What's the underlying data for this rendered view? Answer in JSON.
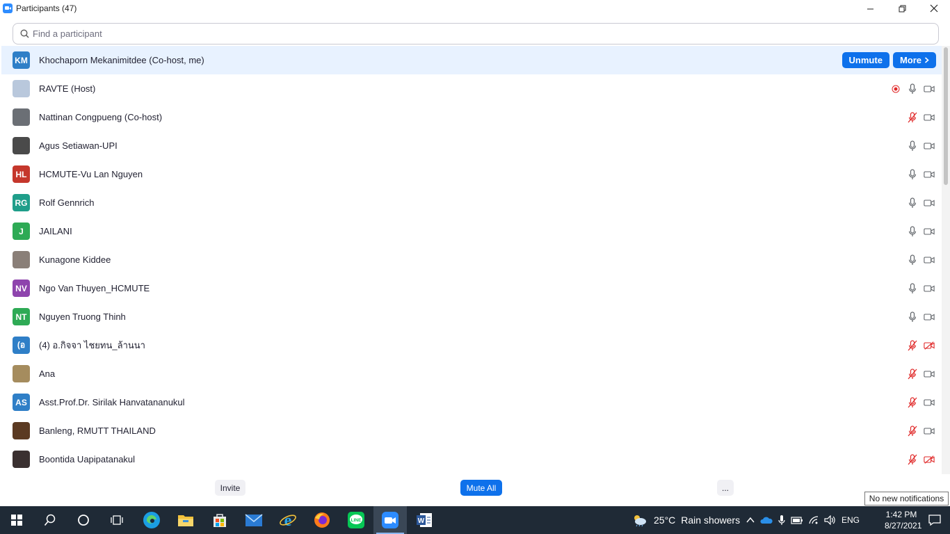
{
  "window": {
    "title": "Participants (47)",
    "minimize": "—",
    "restore": "❐",
    "close": "✕"
  },
  "search": {
    "placeholder": "Find a participant"
  },
  "participants": [
    {
      "initials": "KM",
      "name": "Khochaporn Mekanimitdee (Co-host, me)",
      "color": "#2f7fc7",
      "mic": "none",
      "video": "none",
      "actions": {
        "unmute": "Unmute",
        "more": "More"
      }
    },
    {
      "initials": "",
      "name": "RAVTE (Host)",
      "color": "#b9c8dc",
      "mic": "on",
      "video": "on",
      "recording": true
    },
    {
      "initials": "",
      "name": "Nattinan Congpueng (Co-host)",
      "color": "#6b6f75",
      "mic": "muted",
      "video": "on"
    },
    {
      "initials": "",
      "name": "Agus Setiawan-UPI",
      "color": "#4a4a4a",
      "mic": "on",
      "video": "on"
    },
    {
      "initials": "HL",
      "name": "HCMUTE-Vu Lan Nguyen",
      "color": "#c5372c",
      "mic": "on",
      "video": "on"
    },
    {
      "initials": "RG",
      "name": "Rolf Gennrich",
      "color": "#1f9e8a",
      "mic": "on",
      "video": "on"
    },
    {
      "initials": "J",
      "name": "JAILANI",
      "color": "#2eaa55",
      "mic": "on",
      "video": "on"
    },
    {
      "initials": "",
      "name": "Kunagone Kiddee",
      "color": "#8a7f78",
      "mic": "on",
      "video": "on"
    },
    {
      "initials": "NV",
      "name": "Ngo Van Thuyen_HCMUTE",
      "color": "#8e44ad",
      "mic": "on",
      "video": "on"
    },
    {
      "initials": "NT",
      "name": "Nguyen Truong Thinh",
      "color": "#2eaa55",
      "mic": "on",
      "video": "on"
    },
    {
      "initials": "(อ",
      "name": "(4) อ.กิจจา  ไชยทน_ล้านนา",
      "color": "#2f7fc7",
      "mic": "muted",
      "video": "off"
    },
    {
      "initials": "",
      "name": "Ana",
      "color": "#a58c5e",
      "mic": "muted",
      "video": "on"
    },
    {
      "initials": "AS",
      "name": "Asst.Prof.Dr. Sirilak Hanvatananukul",
      "color": "#2f7fc7",
      "mic": "muted",
      "video": "on"
    },
    {
      "initials": "",
      "name": "Banleng, RMUTT THAILAND",
      "color": "#5b3a22",
      "mic": "muted",
      "video": "on"
    },
    {
      "initials": "",
      "name": "Boontida Uapipatanakul",
      "color": "#3a3030",
      "mic": "muted",
      "video": "off"
    }
  ],
  "footer": {
    "invite": "Invite",
    "mute_all": "Mute All",
    "more": "..."
  },
  "notification": "No new notifications",
  "taskbar": {
    "weather_temp": "25°C",
    "weather_text": "Rain showers",
    "language": "ENG",
    "time": "1:42 PM",
    "date": "8/27/2021"
  },
  "colors": {
    "accent": "#0e71eb",
    "highlight_row": "#e8f2ff",
    "muted_red": "#e02828",
    "taskbar": "#1f2a36"
  }
}
